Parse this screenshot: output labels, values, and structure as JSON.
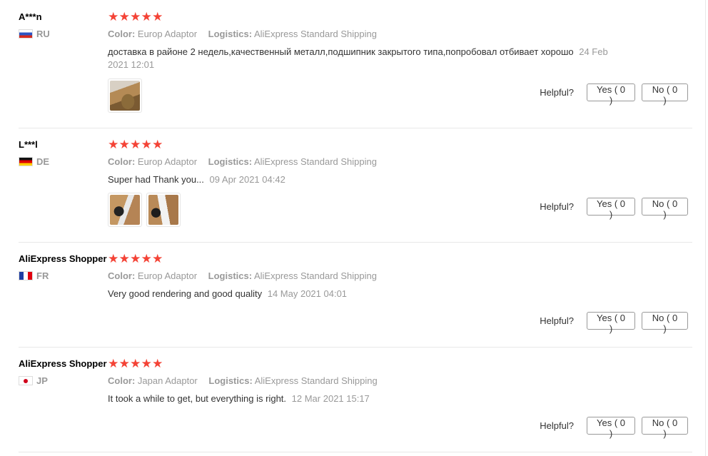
{
  "reviews": [
    {
      "user": "A***n",
      "country": "RU",
      "stars": 5,
      "color_label": "Color:",
      "color_value": "Europ Adaptor",
      "logistics_label": "Logistics:",
      "logistics_value": "AliExpress Standard Shipping",
      "text": "доставка в районе 2 недель,качественный металл,подшипник закрытого типа,попробовал отбивает хорошо",
      "date": "24 Feb 2021 12:01",
      "helpful_label": "Helpful?",
      "yes_label": "Yes ( 0 )",
      "no_label": "No ( 0 )"
    },
    {
      "user": "L***l",
      "country": "DE",
      "stars": 5,
      "color_label": "Color:",
      "color_value": "Europ Adaptor",
      "logistics_label": "Logistics:",
      "logistics_value": "AliExpress Standard Shipping",
      "text": "Super had Thank you...",
      "date": "09 Apr 2021 04:42",
      "helpful_label": "Helpful?",
      "yes_label": "Yes ( 0 )",
      "no_label": "No ( 0 )"
    },
    {
      "user": "AliExpress Shopper",
      "country": "FR",
      "stars": 5,
      "color_label": "Color:",
      "color_value": "Europ Adaptor",
      "logistics_label": "Logistics:",
      "logistics_value": "AliExpress Standard Shipping",
      "text": "Very good rendering and good quality",
      "date": "14 May 2021 04:01",
      "helpful_label": "Helpful?",
      "yes_label": "Yes ( 0 )",
      "no_label": "No ( 0 )"
    },
    {
      "user": "AliExpress Shopper",
      "country": "JP",
      "stars": 5,
      "color_label": "Color:",
      "color_value": "Japan Adaptor",
      "logistics_label": "Logistics:",
      "logistics_value": "AliExpress Standard Shipping",
      "text": "It took a while to get, but everything is right.",
      "date": "12 Mar 2021 15:17",
      "helpful_label": "Helpful?",
      "yes_label": "Yes ( 0 )",
      "no_label": "No ( 0 )"
    }
  ],
  "colors": {
    "star": "#f44336",
    "muted": "#999999",
    "divider": "#e8e8e8"
  }
}
